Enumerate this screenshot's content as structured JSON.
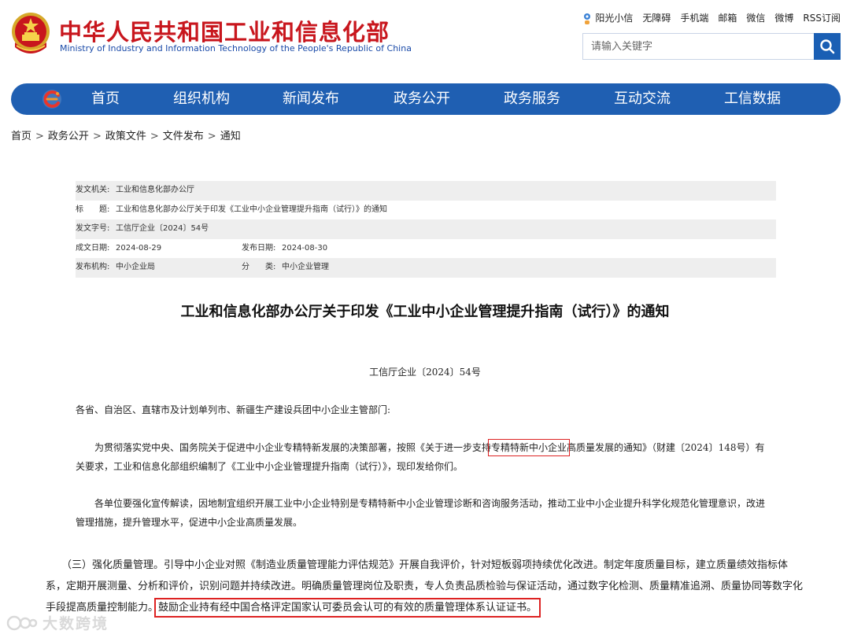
{
  "header": {
    "site_name_cn": "中华人民共和国工业和信息化部",
    "site_name_en": "Ministry of Industry and Information Technology of the People's Republic of China",
    "top_links": [
      "阳光小信",
      "无障碍",
      "手机端",
      "邮箱",
      "微信",
      "微博",
      "RSS订阅"
    ],
    "search_placeholder": "请输入关键字"
  },
  "nav": {
    "items": [
      "首页",
      "组织机构",
      "新闻发布",
      "政务公开",
      "政务服务",
      "互动交流",
      "工信数据"
    ]
  },
  "breadcrumb": [
    "首页",
    "政务公开",
    "政策文件",
    "文件发布",
    "通知"
  ],
  "meta": {
    "issuer_label": "发文机关:",
    "issuer_value": "工业和信息化部办公厅",
    "title_label": "标　　题:",
    "title_value": "工业和信息化部办公厅关于印发《工业中小企业管理提升指南（试行）》的通知",
    "docno_label": "发文字号:",
    "docno_value": "工信厅企业〔2024〕54号",
    "created_label": "成文日期:",
    "created_value": "2024-08-29",
    "published_label": "发布日期:",
    "published_value": "2024-08-30",
    "org_label": "发布机构:",
    "org_value": "中小企业局",
    "category_label": "分　　类:",
    "category_value": "中小企业管理"
  },
  "document": {
    "title": "工业和信息化部办公厅关于印发《工业中小企业管理提升指南（试行）》的通知",
    "doc_number": "工信厅企业〔2024〕54号",
    "salutation": "各省、自治区、直辖市及计划单列市、新疆生产建设兵团中小企业主管部门:",
    "para1_before": "为贯彻落实党中央、国务院关于促进中小企业专精特新发展的决策部署，按照《关于进一步支持",
    "para1_highlight": "专精特新中小企业",
    "para1_after": "高质量发展的通知》（财建〔2024〕148号）有关要求，工业和信息化部组织编制了《工业中小企业管理提升指南（试行）》，现印发给你们。",
    "para2": "各单位要强化宣传解读，因地制宜组织开展工业中小企业特别是专精特新中小企业管理诊断和咨询服务活动，推动工业中小企业提升科学化规范化管理意识，改进管理措施，提升管理水平，促进中小企业高质量发展。",
    "para3_before": "（三）强化质量管理。引导中小企业对照《制造业质量管理能力评估规范》开展自我评价，针对短板弱项持续优化改进。制定年度质量目标，建立质量绩效指标体系，定期开展测量、分析和评价，识别问题并持续改进。明确质量管理岗位及职责，专人负责品质检验与保证活动，通过数字化检测、质量精准追溯、质量协同等数字化手段提高质量控制能力。",
    "para3_highlight": "鼓励企业持有经中国合格评定国家认可委员会认可的有效的质量管理体系认证证书。"
  },
  "watermark": {
    "text": "大数跨境"
  }
}
